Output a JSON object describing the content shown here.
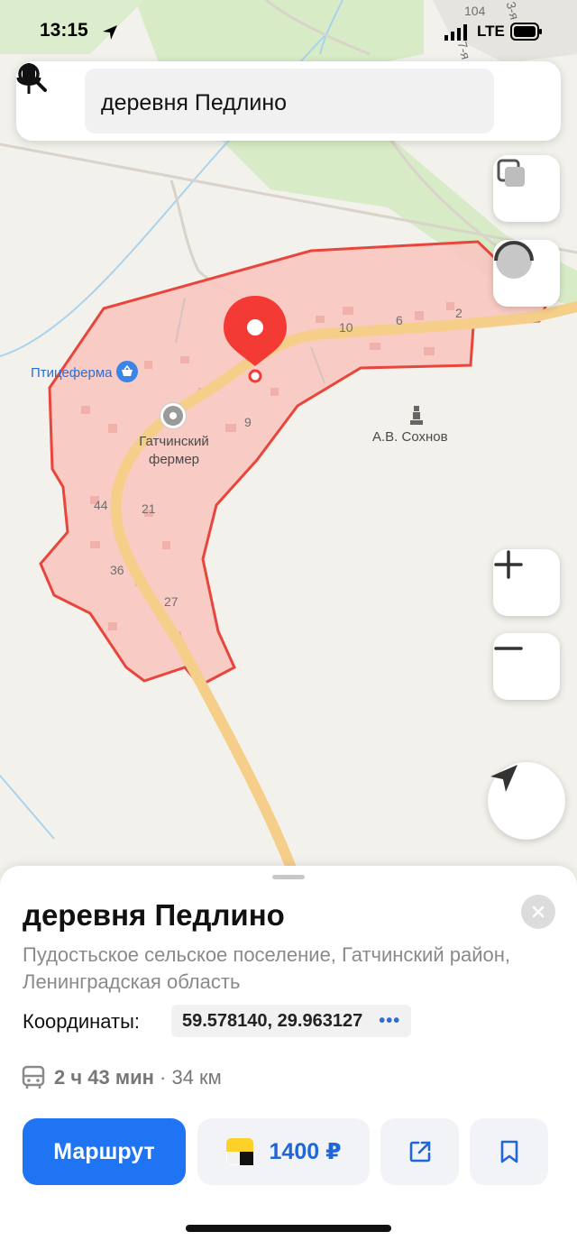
{
  "status_bar": {
    "time": "13:15",
    "network": "LTE"
  },
  "search": {
    "query": "деревня Педлино"
  },
  "map": {
    "corner_labels": [
      "104",
      "3-я",
      "7-я"
    ],
    "house_numbers": [
      "10",
      "6",
      "2",
      "9",
      "44",
      "21",
      "36",
      "27"
    ],
    "pois": {
      "poultry_farm": "Птицеферма",
      "farmer": "Гатчинский фермер",
      "monument": "А.В. Сохнов"
    },
    "highlight_color": "#f28b82",
    "pin_color": "#f43a34"
  },
  "place": {
    "title": "деревня Педлино",
    "subtitle": "Пудостьское сельское поселение, Гатчинский район, Ленинградская область",
    "coords_label": "Координаты:",
    "coords_value": "59.578140, 29.963127",
    "route_time": "2 ч 43 мин",
    "route_distance": "· 34 км"
  },
  "actions": {
    "route_label": "Маршрут",
    "taxi_price": "1400 ₽"
  },
  "colors": {
    "accent": "#1f74f4"
  }
}
